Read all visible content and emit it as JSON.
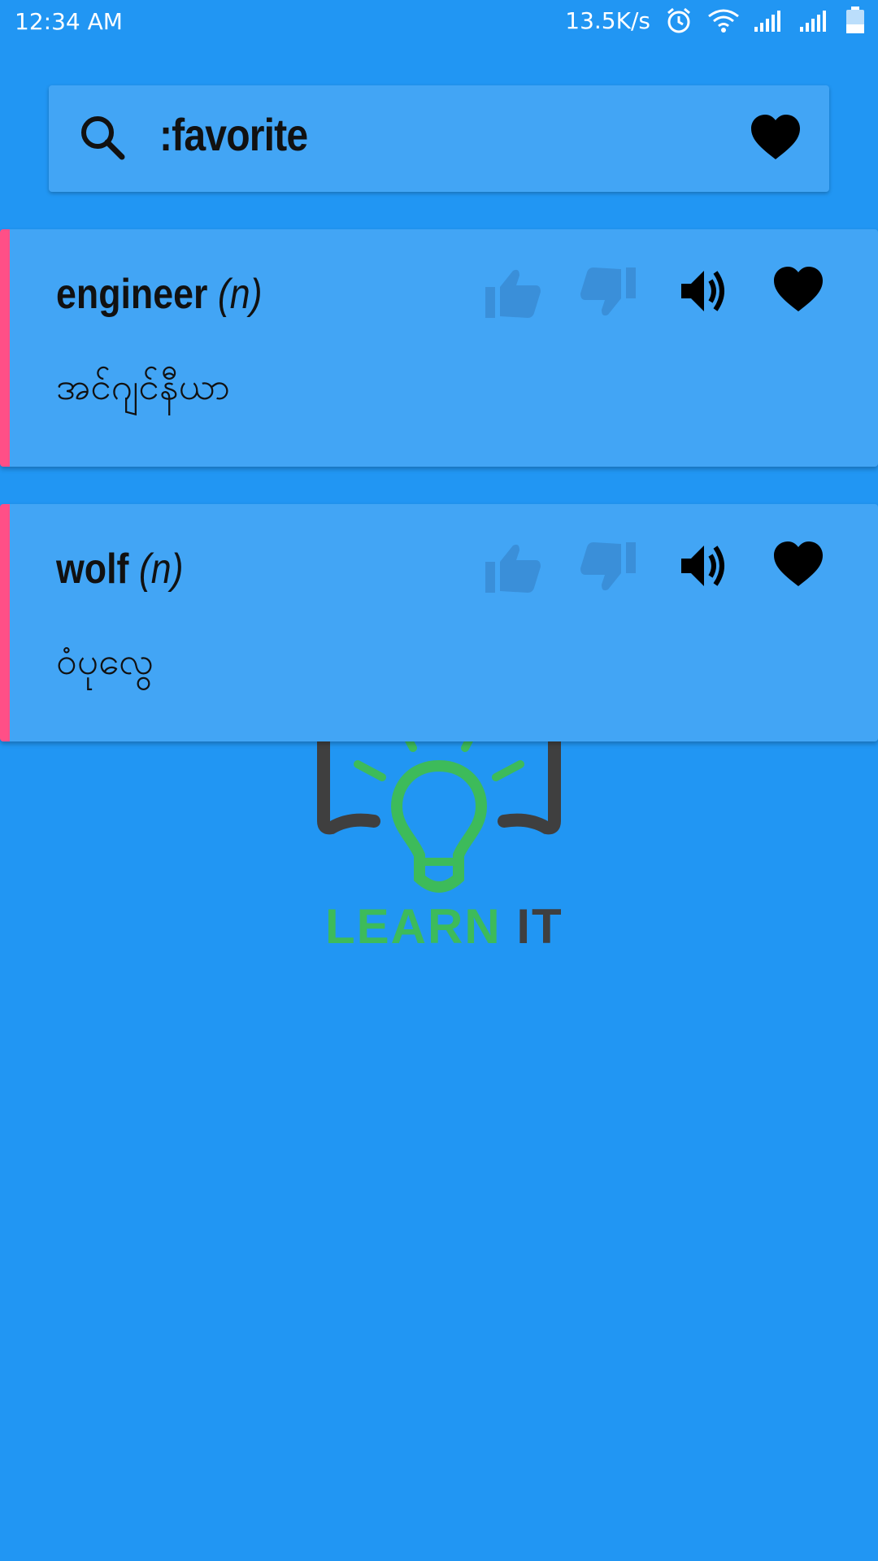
{
  "status_bar": {
    "time": "12:34 AM",
    "net_speed": "13.5K/s",
    "icons": [
      "alarm-icon",
      "wifi-icon",
      "signal-icon",
      "signal-icon",
      "battery-icon"
    ]
  },
  "search": {
    "query": ":favorite",
    "icon": "search-icon",
    "favorite_icon": "heart-icon"
  },
  "words": [
    {
      "word": "engineer",
      "pos": "(n)",
      "meaning": "အင်ဂျင်နီယာ",
      "actions": [
        "thumbs-up-icon",
        "thumbs-down-icon",
        "speaker-icon",
        "heart-icon"
      ]
    },
    {
      "word": "wolf",
      "pos": "(n)",
      "meaning": "ဝံပုလွေ",
      "actions": [
        "thumbs-up-icon",
        "thumbs-down-icon",
        "speaker-icon",
        "heart-icon"
      ]
    }
  ],
  "logo": {
    "text_learn": "LEARN",
    "text_it": "IT"
  },
  "colors": {
    "background": "#2196F3",
    "card": "#42A5F5",
    "card_accent": "#FF4F87",
    "logo_green": "#3DBB5A",
    "logo_dark": "#3F3F3F"
  }
}
